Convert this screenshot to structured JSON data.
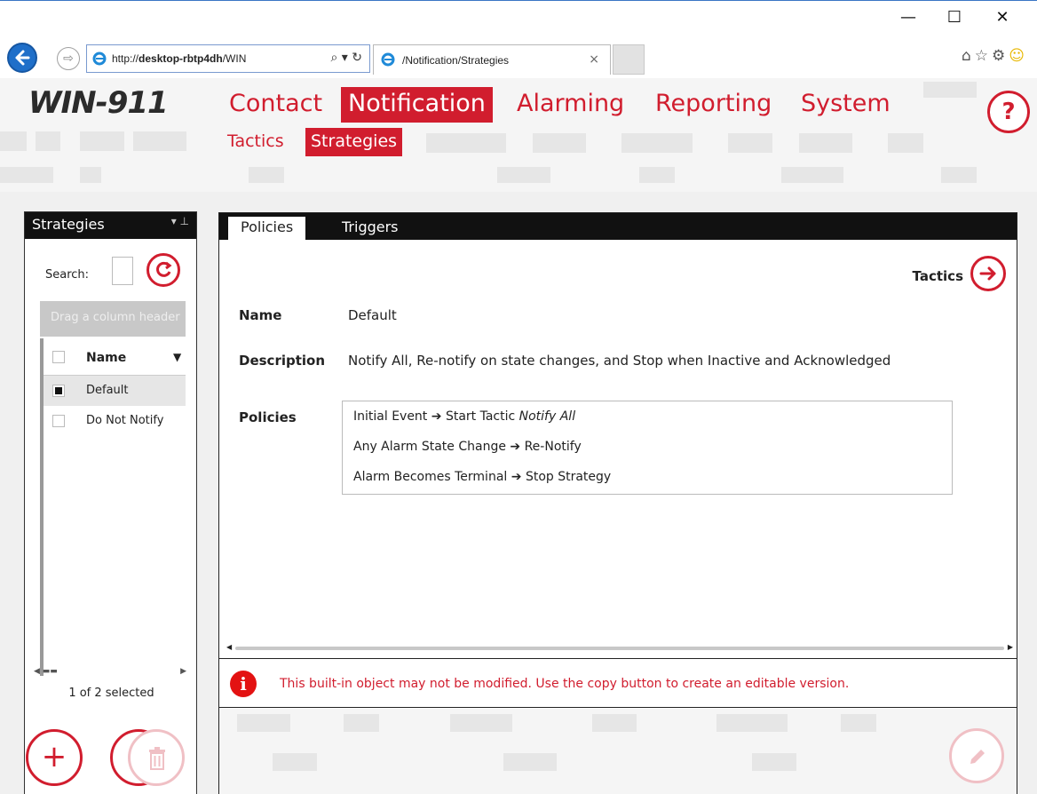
{
  "browser": {
    "url_prefix": "http://",
    "url_host": "desktop-rbtp4dh",
    "url_rest": "/WIN",
    "address_tools": "⌕ ▾ ↻",
    "tab_title": "/Notification/Strategies",
    "tab_close": "×",
    "window_min": "—",
    "window_max": "☐",
    "window_close": "✕",
    "icons": [
      "home-icon",
      "star-icon",
      "gear-icon",
      "smiley-icon"
    ]
  },
  "app": {
    "logo": "WIN-911",
    "nav": [
      "Contact",
      "Notification",
      "Alarming",
      "Reporting",
      "System"
    ],
    "active_nav": "Notification",
    "subnav": [
      "Tactics",
      "Strategies"
    ],
    "active_subnav": "Strategies",
    "help_label": "?"
  },
  "left_panel": {
    "title": "Strategies",
    "search_label": "Search:",
    "group_hint": "Drag a column header",
    "column_name": "Name",
    "rows": [
      {
        "name": "Default",
        "selected": true
      },
      {
        "name": "Do Not Notify",
        "selected": false
      }
    ],
    "selection_count": "1 of 2 selected",
    "add_label": "+"
  },
  "main_panel": {
    "tabs": [
      "Policies",
      "Triggers"
    ],
    "active_tab": "Policies",
    "tactics_link": "Tactics",
    "labels": {
      "name": "Name",
      "description": "Description",
      "policies": "Policies"
    },
    "name": "Default",
    "description": "Notify All, Re-notify on state changes, and Stop when Inactive and Acknowledged",
    "policies": [
      {
        "trigger": "Initial Event",
        "action": "Start Tactic",
        "target": "Notify All"
      },
      {
        "trigger": "Any Alarm State Change",
        "action": "Re-Notify",
        "target": ""
      },
      {
        "trigger": "Alarm Becomes Terminal",
        "action": "Stop Strategy",
        "target": ""
      }
    ],
    "arrow": "➔",
    "warning_icon": "i",
    "warning": "This built-in object may not be modified. Use the copy button to create an editable version."
  },
  "colors": {
    "brand_red": "#d11d2e",
    "warning_red": "#e31212",
    "header_black": "#111111"
  }
}
